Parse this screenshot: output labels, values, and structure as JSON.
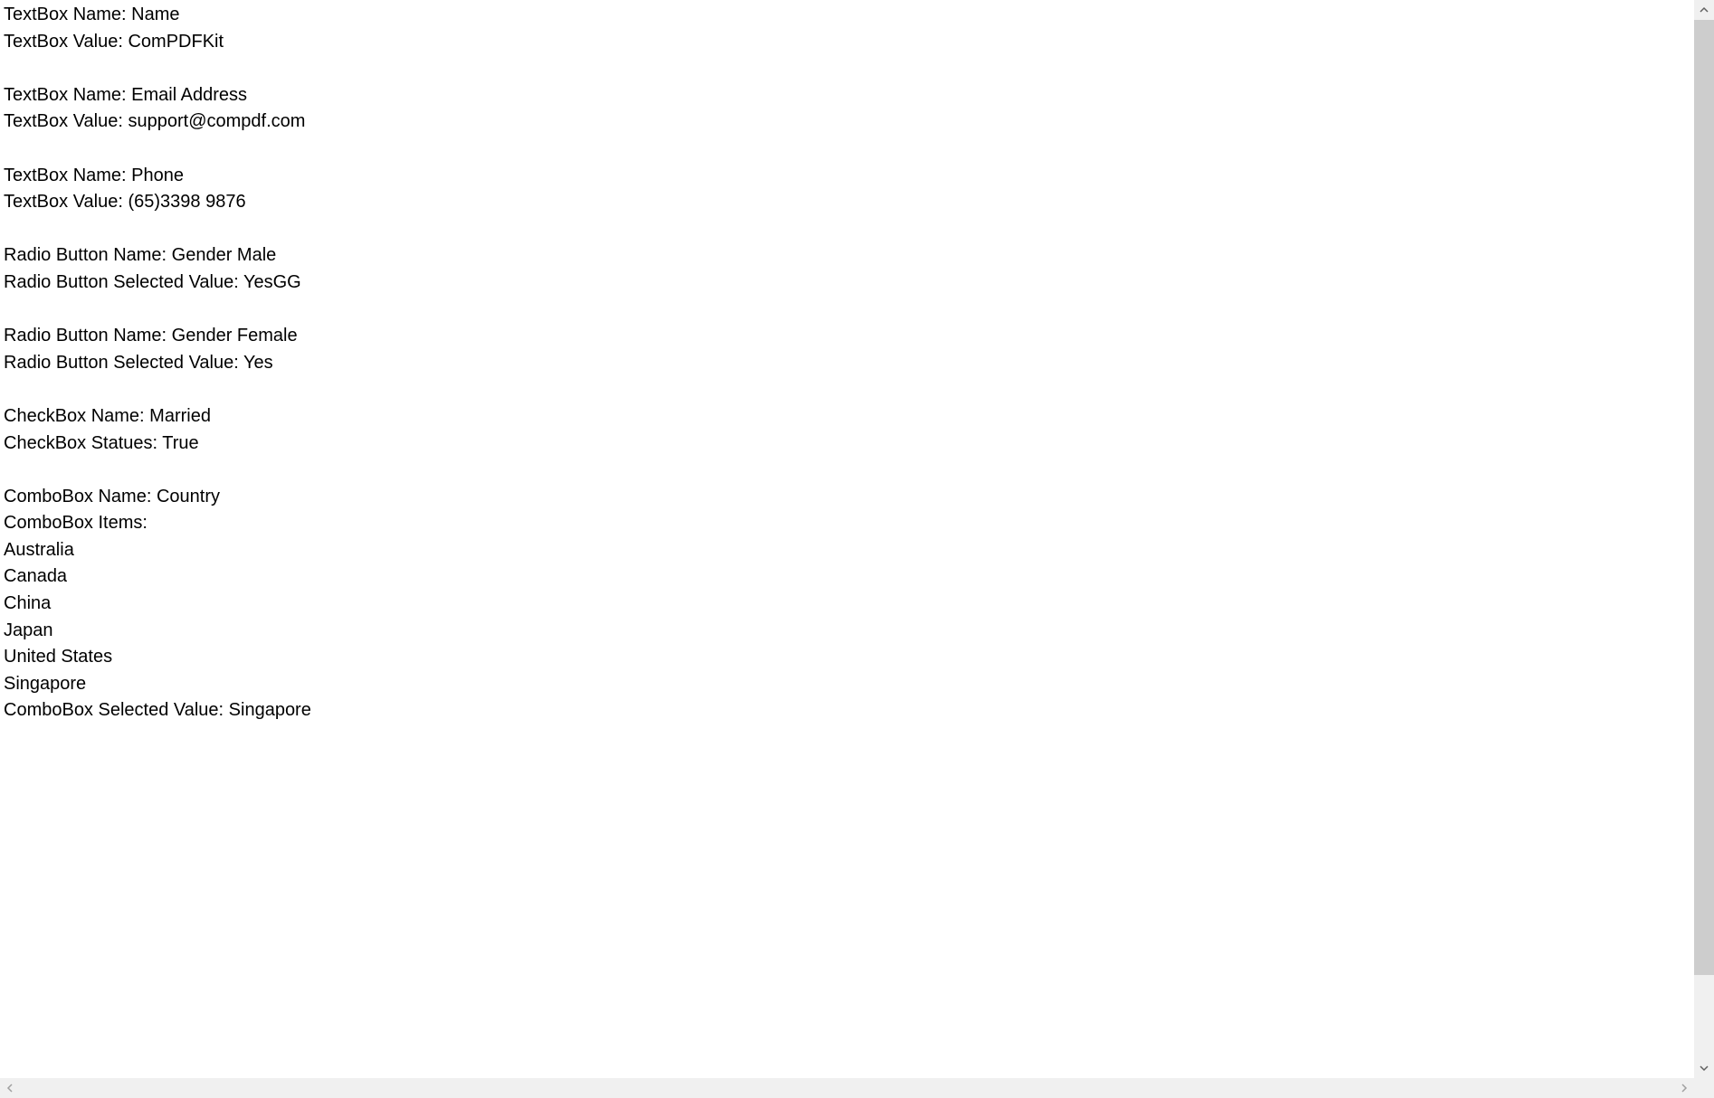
{
  "fields": [
    {
      "type": "TextBox",
      "name_label": "TextBox Name: ",
      "name": "Name",
      "value_label": "TextBox Value: ",
      "value": "ComPDFKit"
    },
    {
      "type": "TextBox",
      "name_label": "TextBox Name: ",
      "name": "Email Address",
      "value_label": "TextBox Value: ",
      "value": "support@compdf.com"
    },
    {
      "type": "TextBox",
      "name_label": "TextBox Name: ",
      "name": "Phone",
      "value_label": "TextBox Value: ",
      "value": "(65)3398 9876"
    },
    {
      "type": "RadioButton",
      "name_label": "Radio Button Name: ",
      "name": "Gender Male",
      "value_label": "Radio Button Selected Value: ",
      "value": "YesGG"
    },
    {
      "type": "RadioButton",
      "name_label": "Radio Button Name: ",
      "name": "Gender Female",
      "value_label": "Radio Button Selected Value: ",
      "value": "Yes"
    },
    {
      "type": "CheckBox",
      "name_label": "CheckBox Name: ",
      "name": "Married",
      "value_label": "CheckBox Statues: ",
      "value": "True"
    }
  ],
  "combo": {
    "name_label": "ComboBox Name: ",
    "name": "Country",
    "items_label": "ComboBox Items:",
    "items": [
      "Australia",
      "Canada",
      "China",
      "Japan",
      "United States",
      "Singapore"
    ],
    "selected_label": "ComboBox Selected Value: ",
    "selected": "Singapore"
  }
}
